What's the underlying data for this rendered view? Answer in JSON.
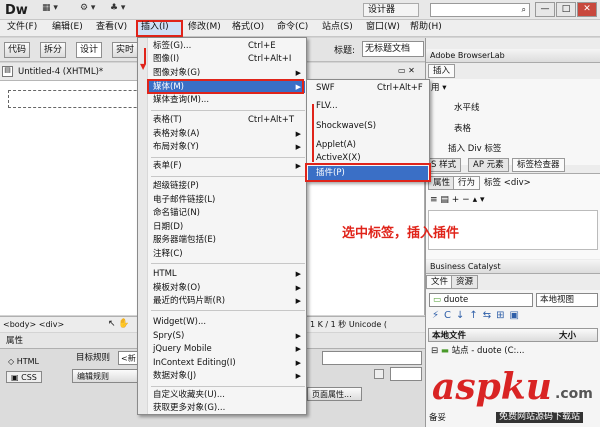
{
  "titlebar": {
    "app": "Dw",
    "workspace": "设计器",
    "win_min": "—",
    "win_max": "□",
    "win_close": "✕"
  },
  "menubar": [
    "文件(F)",
    "编辑(E)",
    "查看(V)",
    "插入(I)",
    "修改(M)",
    "格式(O)",
    "命令(C)",
    "站点(S)",
    "窗口(W)",
    "帮助(H)"
  ],
  "doc_toolbar": {
    "views": [
      "代码",
      "拆分",
      "设计",
      "实时"
    ],
    "title_label": "标题:",
    "title_value": "无标题文档"
  },
  "document": {
    "tab": "Untitled-4 (XHTML)*",
    "status_left": "<body> <div>",
    "status_right": "1 K / 1 秒  Unicode (",
    "properties_label": "属性",
    "html_button": "HTML",
    "css_button": "CSS",
    "target_rule": "目标规则",
    "target_value": "<新",
    "edit_rule": "编辑规则",
    "page_props": "页面属性..."
  },
  "insert_menu": {
    "items": [
      {
        "label": "标签(G)...",
        "shortcut": "Ctrl+E"
      },
      {
        "label": "图像(I)",
        "shortcut": "Ctrl+Alt+I"
      },
      {
        "label": "图像对象(G)",
        "shortcut": ""
      },
      {
        "label": "媒体(M)",
        "shortcut": ""
      },
      {
        "label": "媒体查询(M)...",
        "shortcut": ""
      },
      {
        "label": "表格(T)",
        "shortcut": "Ctrl+Alt+T"
      },
      {
        "label": "表格对象(A)",
        "shortcut": ""
      },
      {
        "label": "布局对象(Y)",
        "shortcut": ""
      },
      {
        "label": "表单(F)",
        "shortcut": ""
      },
      {
        "label": "超级链接(P)",
        "shortcut": ""
      },
      {
        "label": "电子邮件链接(L)",
        "shortcut": ""
      },
      {
        "label": "命名锚记(N)",
        "shortcut": ""
      },
      {
        "label": "日期(D)",
        "shortcut": ""
      },
      {
        "label": "服务器端包括(E)",
        "shortcut": ""
      },
      {
        "label": "注释(C)",
        "shortcut": ""
      },
      {
        "label": "HTML",
        "shortcut": ""
      },
      {
        "label": "模板对象(O)",
        "shortcut": ""
      },
      {
        "label": "最近的代码片断(R)",
        "shortcut": ""
      },
      {
        "label": "Widget(W)...",
        "shortcut": ""
      },
      {
        "label": "Spry(S)",
        "shortcut": ""
      },
      {
        "label": "jQuery Mobile",
        "shortcut": ""
      },
      {
        "label": "InContext Editing(I)",
        "shortcut": ""
      },
      {
        "label": "数据对象(J)",
        "shortcut": ""
      },
      {
        "label": "自定义收藏夹(U)...",
        "shortcut": ""
      },
      {
        "label": "获取更多对象(G)...",
        "shortcut": ""
      }
    ]
  },
  "media_menu": {
    "items": [
      {
        "label": "SWF",
        "shortcut": "Ctrl+Alt+F"
      },
      {
        "label": "FLV..."
      },
      {
        "label": "Shockwave(S)"
      },
      {
        "label": "Applet(A)"
      },
      {
        "label": "ActiveX(X)"
      },
      {
        "label": "插件(P)"
      }
    ]
  },
  "annotation": "选中标签，插入插件",
  "right_panels": {
    "browserlab": "Adobe BrowserLab",
    "insert_tab": "插入",
    "common": "用 ▾",
    "insert_items": [
      "水平线",
      "表格",
      "插入 Div 标签"
    ],
    "css_tabs": [
      "S 样式",
      "AP 元素",
      "标签检查器"
    ],
    "attr_tabs": [
      "属性",
      "行为",
      "标签 <div>"
    ],
    "bc_title": "Business Catalyst",
    "files_tabs": [
      "文件",
      "资源"
    ],
    "site": "duote",
    "view": "本地视图",
    "local_files": "本地文件",
    "size": "大小",
    "site_row": "站点 - duote (C:...",
    "ready": "备妥"
  },
  "watermark": {
    "logo": "aspku",
    "tld": ".com",
    "tagline": "免费网站源码下载站"
  }
}
